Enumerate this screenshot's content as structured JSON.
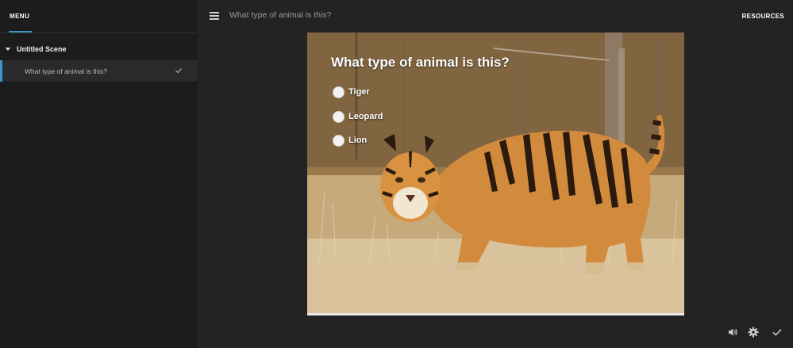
{
  "sidebar": {
    "tab_label": "MENU",
    "scene": {
      "label": "Untitled Scene"
    },
    "slides": [
      {
        "label": "What type of animal is this?",
        "completed": true
      }
    ]
  },
  "topbar": {
    "title": "What type of animal is this?",
    "resources_label": "RESOURCES"
  },
  "slide": {
    "question": "What type of animal is this?",
    "options": [
      {
        "label": "Tiger"
      },
      {
        "label": "Leopard"
      },
      {
        "label": "Lion"
      }
    ]
  },
  "controls": {
    "icons": [
      "volume-icon",
      "settings-icon",
      "checkmark-icon"
    ]
  },
  "colors": {
    "accent": "#3d97c6",
    "sidebar_bg": "#1c1c1d",
    "main_bg": "#232324"
  }
}
